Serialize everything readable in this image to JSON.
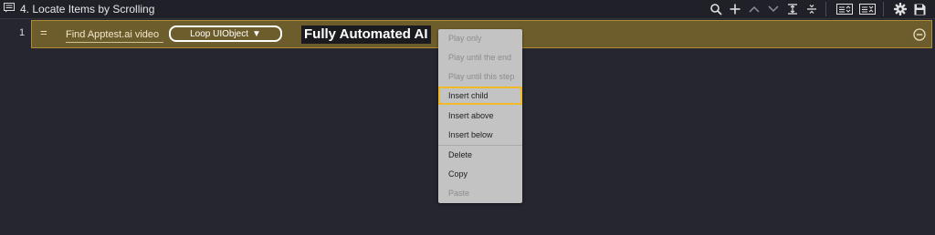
{
  "header": {
    "title": "4. Locate Items by Scrolling",
    "title_icon": "comment-icon",
    "toolbar": [
      {
        "name": "search-icon"
      },
      {
        "name": "plus-icon"
      },
      {
        "name": "chevron-up-icon"
      },
      {
        "name": "chevron-down-icon"
      },
      {
        "name": "expand-all-icon"
      },
      {
        "name": "collapse-all-icon"
      },
      {
        "name": "expand-list-icon"
      },
      {
        "name": "collapse-list-icon"
      },
      {
        "name": "gear-icon"
      },
      {
        "name": "save-icon"
      }
    ]
  },
  "step": {
    "line_number": "1",
    "drag_handle": "=",
    "name": "Find Apptest.ai video",
    "action_label": "Loop UIObject",
    "action_arrow": "▼",
    "caption": "Fully Automated AI",
    "row_color": "#6e5d2c",
    "row_border": "#b08d35"
  },
  "context_menu": {
    "items": [
      {
        "label": "Play only",
        "enabled": false
      },
      {
        "label": "Play until the end",
        "enabled": false
      },
      {
        "label": "Play until this step",
        "enabled": false
      },
      {
        "label": "Insert child",
        "enabled": true,
        "highlighted": true
      },
      {
        "label": "Insert above",
        "enabled": true
      },
      {
        "label": "Insert below",
        "enabled": true
      },
      {
        "label": "Delete",
        "enabled": true
      },
      {
        "label": "Copy",
        "enabled": true
      },
      {
        "label": "Paste",
        "enabled": false
      }
    ],
    "highlight_color": "#f1b928"
  }
}
